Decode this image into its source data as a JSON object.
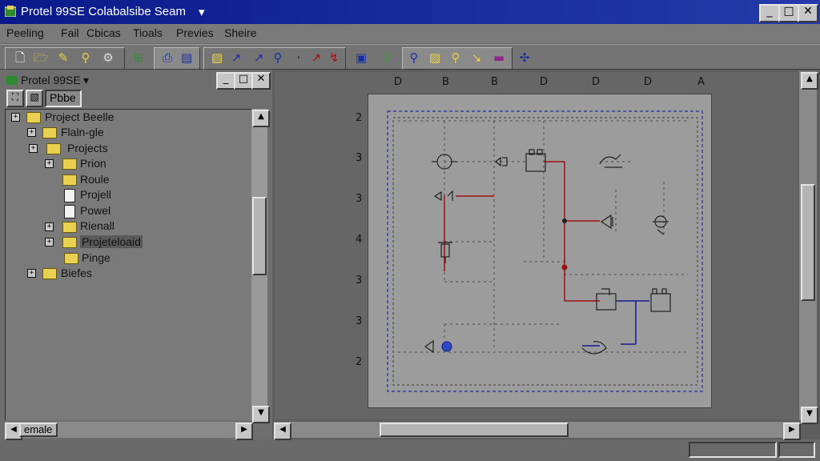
{
  "window": {
    "title": "Protel 99SE  Colabalsibe Seam",
    "title_dropdown": "▾",
    "minimize": "_",
    "maximize": "□",
    "close": "✕"
  },
  "menu": [
    "Peeling",
    "Fail",
    "Cbicas",
    "Tioals",
    "Previes",
    "Sheire"
  ],
  "panel": {
    "title": "Protel 99SE",
    "title_dropdown": "▾",
    "tab_label": "Pbbe",
    "tree": [
      {
        "label": "Project Beelle",
        "icon": "folder",
        "expander": "+"
      },
      {
        "label": "Flaln-gle",
        "icon": "folder",
        "expander": "+"
      },
      {
        "label": "Projects",
        "icon": "folder",
        "expander": "+"
      },
      {
        "label": "Prion",
        "icon": "folder",
        "expander": "+"
      },
      {
        "label": "Roule",
        "icon": "folder",
        "expander": ""
      },
      {
        "label": "Projell",
        "icon": "document",
        "expander": ""
      },
      {
        "label": "Powel",
        "icon": "document",
        "expander": ""
      },
      {
        "label": "Rienall",
        "icon": "folder",
        "expander": "+"
      },
      {
        "label": "Projeteloaid",
        "icon": "folder",
        "expander": "+"
      },
      {
        "label": "Pinge",
        "icon": "folder",
        "expander": ""
      },
      {
        "label": "Biefes",
        "icon": "folder",
        "expander": "+"
      }
    ],
    "hscroll_label": "emale"
  },
  "schematic": {
    "top_ruler": [
      "D",
      "B",
      "B",
      "D",
      "D",
      "D",
      "A"
    ],
    "left_ruler": [
      "2",
      "3",
      "3",
      "4",
      "3",
      "3",
      "2"
    ],
    "colors": {
      "wire_red": "#a01010",
      "wire_blue": "#1a1a90",
      "border_blue": "#2a2aa0",
      "grid": "#4a4a4a"
    }
  },
  "colors": {
    "titlebar": "#0a1a8a",
    "face": "#c6c6c6",
    "folder": "#e8d050"
  }
}
